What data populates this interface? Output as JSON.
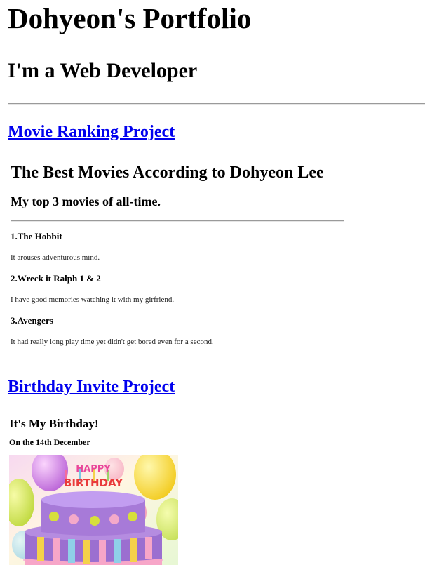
{
  "header": {
    "title": "Dohyeon's Portfolio",
    "subtitle": "I'm a Web Developer"
  },
  "projects": [
    {
      "link_label": "Movie Ranking Project",
      "embed": {
        "title": "The Best Movies According to Dohyeon Lee",
        "subtitle": "My top 3 movies of all-time.",
        "movies": [
          {
            "title": "1.The Hobbit",
            "description": "It arouses adventurous mind."
          },
          {
            "title": "2.Wreck it Ralph 1 & 2",
            "description": "I have good memories watching it with my girfriend."
          },
          {
            "title": "3.Avengers",
            "description": "It had really long play time yet didn't get bored even for a second."
          }
        ]
      }
    },
    {
      "link_label": "Birthday Invite Project",
      "embed": {
        "title": "It's My Birthday!",
        "date": "On the 14th December",
        "image": {
          "subject": "birthday-cake",
          "topper_text": [
            "HAPPY",
            "BIRTHDAY"
          ]
        }
      }
    }
  ],
  "colors": {
    "link": "#0000ee",
    "text": "#000000",
    "rule": "#9a9a9a"
  }
}
